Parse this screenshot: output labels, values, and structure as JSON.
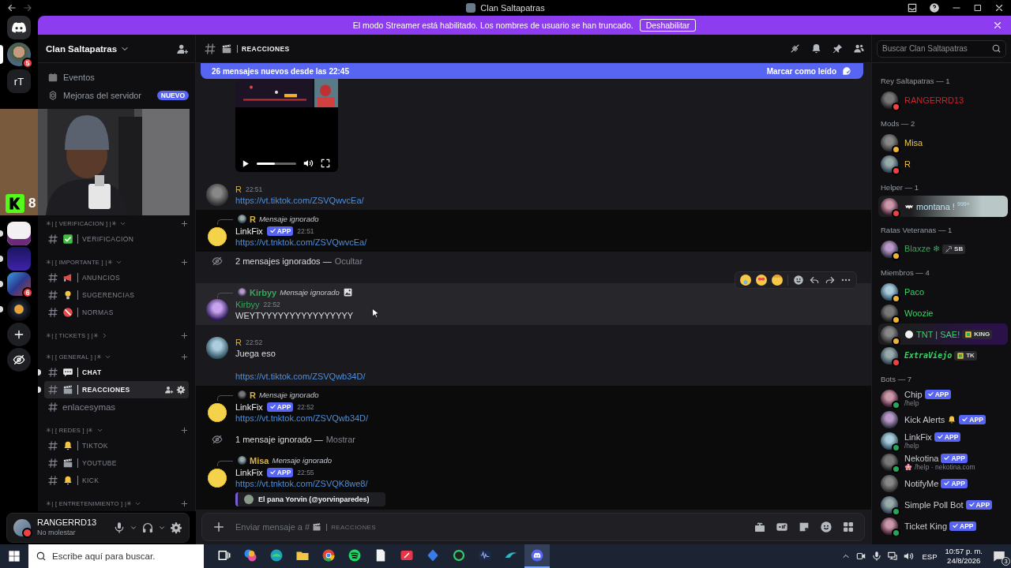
{
  "titlebar": {
    "title": "Clan Saltapatras"
  },
  "banner": {
    "text": "El modo Streamer está habilitado. Los nombres de usuario se han truncado.",
    "button": "Deshabilitar"
  },
  "server_rail": {
    "top": [
      {
        "kind": "home",
        "selected": false,
        "unread": false
      },
      {
        "kind": "avatar",
        "badge": "5",
        "selected": true,
        "unread": false
      },
      {
        "kind": "text",
        "label": "rT",
        "selected": false,
        "unread": false
      }
    ],
    "bottom": [
      {
        "kind": "dm",
        "selected": false,
        "unread": true
      },
      {
        "kind": "f",
        "selected": false,
        "unread": true
      },
      {
        "kind": "hat",
        "badge": "6",
        "selected": false,
        "unread": true
      },
      {
        "kind": "lamp",
        "selected": false,
        "unread": true
      },
      {
        "kind": "add",
        "selected": false,
        "unread": false
      },
      {
        "kind": "explore",
        "selected": false,
        "unread": false
      }
    ]
  },
  "webcam": {
    "kind": "picture",
    "overlay_count": "8"
  },
  "sidebar": {
    "server_name": "Clan Saltapatras",
    "links": [
      {
        "kind": "events",
        "label": "Eventos"
      },
      {
        "kind": "boost",
        "label": "Mejoras del servidor",
        "badge": "NUEVO"
      }
    ],
    "categories": [
      {
        "name": "✳| [ VERIFICACION ] |✳",
        "expanded": true,
        "channels": [
          {
            "kind": "check",
            "name": "VERIFICACION",
            "selected": false,
            "unread": false
          }
        ]
      },
      {
        "name": "✳| [ IMPORTANTE ] |✳",
        "expanded": true,
        "channels": [
          {
            "kind": "megaphone",
            "name": "ANUNCIOS",
            "selected": false,
            "unread": false
          },
          {
            "kind": "bulb",
            "name": "SUGERENCIAS",
            "selected": false,
            "unread": false
          },
          {
            "kind": "noentry",
            "name": "NORMAS",
            "selected": false,
            "unread": false
          }
        ]
      },
      {
        "name": "✳| [ TICKETS ] |✳",
        "expanded": false
      },
      {
        "name": "✳| [ GENERAL ] |✳",
        "expanded": true,
        "channels": [
          {
            "kind": "speech",
            "name": "CHAT",
            "selected": false,
            "unread": true
          },
          {
            "kind": "clapper",
            "name": "REACCIONES",
            "selected": true,
            "unread": true
          },
          {
            "kind": "plain",
            "name": "enlacesymas",
            "selected": false,
            "unread": false
          }
        ]
      },
      {
        "name": "✳| [ REDES ] |✳",
        "expanded": true,
        "channels": [
          {
            "kind": "bell",
            "name": "TIKTOK",
            "selected": false,
            "unread": false
          },
          {
            "kind": "clapper",
            "name": "YOUTUBE",
            "selected": false,
            "unread": false
          },
          {
            "kind": "bell",
            "name": "KICK",
            "selected": false,
            "unread": false
          }
        ]
      },
      {
        "name": "✳| [ ENTRETENIMIENTO ] |✳",
        "expanded": true
      }
    ]
  },
  "user_panel": {
    "name": "RANGERRD13",
    "status_text": "No molestar",
    "status": {
      "color": "#f23f43"
    }
  },
  "chat_header": {
    "name": "REACCIONES",
    "search_placeholder": "Buscar Clan Saltapatras"
  },
  "new_messages": {
    "text": "26 mensajes nuevos desde las 22:45",
    "action": "Marcar como leído"
  },
  "messages": [
    {
      "kind": "video",
      "progress": {
        "level": 0.45
      }
    },
    {
      "kind": "message",
      "ignored": false,
      "hovered": false,
      "author": "R",
      "color": "#d9b33e",
      "time": "22:51",
      "lines": [
        {
          "kind": "link",
          "text": "https://vt.tiktok.com/ZSVQwvcEa/",
          "spaced": false
        }
      ]
    },
    {
      "kind": "message",
      "ignored": true,
      "hovered": false,
      "reply": {
        "author": "R",
        "color": "#d9b33e",
        "text": "Mensaje ignorado",
        "attachment": false
      },
      "author": "LinkFix",
      "app_badge": "APP",
      "time": "22:51",
      "lines": [
        {
          "kind": "link",
          "text": "https://vt.tnktok.com/ZSVQwvcEa/",
          "spaced": false
        }
      ]
    },
    {
      "kind": "notice",
      "ignored": false,
      "text": "2 mensajes ignorados —",
      "action": "Ocultar"
    },
    {
      "kind": "message",
      "ignored": false,
      "hovered": true,
      "reply": {
        "author": "Kirbyy",
        "color": "#3ba55c",
        "text": "Mensaje ignorado",
        "attachment": true
      },
      "author": "Kirbyy",
      "color": "#3ba55c",
      "time": "22:52",
      "lines": [
        {
          "kind": "text",
          "text": "WEYTYYYYYYYYYYYYYYYY",
          "spaced": false
        }
      ]
    },
    {
      "kind": "message",
      "ignored": false,
      "hovered": false,
      "author": "R",
      "color": "#d9b33e",
      "time": "22:52",
      "lines": [
        {
          "kind": "text",
          "text": "Juega eso",
          "spaced": false
        },
        {
          "kind": "link",
          "text": "https://vt.tiktok.com/ZSVQwb34D/",
          "spaced": true
        }
      ]
    },
    {
      "kind": "message",
      "ignored": true,
      "hovered": false,
      "reply": {
        "author": "R",
        "color": "#d9b33e",
        "text": "Mensaje ignorado",
        "attachment": false
      },
      "author": "LinkFix",
      "app_badge": "APP",
      "time": "22:52",
      "lines": [
        {
          "kind": "link",
          "text": "https://vt.tnktok.com/ZSVQwb34D/",
          "spaced": false
        }
      ]
    },
    {
      "kind": "notice",
      "ignored": true,
      "text": "1 mensaje ignorado —",
      "action": "Mostrar"
    },
    {
      "kind": "message",
      "ignored": true,
      "hovered": false,
      "reply": {
        "author": "Misa",
        "color": "#d9b33e",
        "text": "Mensaje ignorado",
        "attachment": false
      },
      "author": "LinkFix",
      "app_badge": "APP",
      "time": "22:55",
      "lines": [
        {
          "kind": "link",
          "text": "https://vt.tnktok.com/ZSVQK8we8/",
          "spaced": false
        }
      ],
      "embed": {
        "author": "El pana Yorvin (@yorvinparedes)"
      }
    }
  ],
  "composer": {
    "placeholder": "Enviar mensaje a #",
    "channel": "REACCIONES"
  },
  "member_groups": [
    {
      "title": "Rey Saltapatras — 1",
      "members": [
        {
          "kind": "plain",
          "name": "RANGERRD13",
          "color": "#d61f26",
          "status": {
            "color": "#f23f43"
          }
        }
      ]
    },
    {
      "title": "Mods — 2",
      "members": [
        {
          "kind": "plain",
          "name": "Misa",
          "color": "#e8c547",
          "status": {
            "color": "#f0b232"
          }
        },
        {
          "kind": "plain",
          "name": "R",
          "color": "#e8b84a",
          "status": {
            "color": "#f23f43"
          }
        }
      ]
    },
    {
      "title": "Helper — 1",
      "members": [
        {
          "kind": "bat",
          "name": "montana ! $^{999+}$",
          "color": "#bfe3f0",
          "status": {
            "color": "#f23f43"
          },
          "nameplate": {
            "color": "#b9c7c7"
          }
        }
      ]
    },
    {
      "title": "Ratas Veteranas — 1",
      "members": [
        {
          "kind": "plain",
          "name": "Blaxze ❄",
          "color": "#3ba55c",
          "status": {
            "color": "#f0b232"
          },
          "tag": {
            "kind": "sword",
            "label": "SB"
          }
        }
      ]
    },
    {
      "title": "Miembros — 4",
      "members": [
        {
          "kind": "plain",
          "name": "Paco",
          "color": "#3ecf6a",
          "status": {
            "color": "#f0b232"
          }
        },
        {
          "kind": "plain",
          "name": "Woozie",
          "color": "#3ecf6a",
          "status": {
            "color": "#f0b232"
          }
        },
        {
          "kind": "circle",
          "name": "TNT | SAE!",
          "color": "#3ecf6a",
          "status": {
            "color": "#f0b232"
          },
          "nameplate": {
            "color": "#2a1248"
          },
          "tag": {
            "kind": "frame",
            "label": "KING"
          }
        },
        {
          "kind": "mono",
          "name": "ExtraViejo",
          "color": "#3ecf6a",
          "status": {
            "color": "#f23f43"
          },
          "tag": {
            "kind": "frame",
            "label": "TK"
          }
        }
      ]
    },
    {
      "title": "Bots — 7",
      "members": [
        {
          "kind": "plain",
          "name": "Chip",
          "status": {
            "color": "#23a55a"
          },
          "app_badge": "APP",
          "activity": "/help"
        },
        {
          "kind": "bell",
          "name": "Kick Alerts",
          "app_badge": "APP"
        },
        {
          "kind": "plain",
          "name": "LinkFix",
          "status": {
            "color": "#23a55a"
          },
          "app_badge": "APP",
          "activity": "/help"
        },
        {
          "kind": "flower",
          "name": "Nekotina",
          "status": {
            "color": "#23a55a"
          },
          "app_badge": "APP",
          "activity": "/help · nekotina.com"
        },
        {
          "kind": "plain",
          "name": "NotifyMe",
          "app_badge": "APP"
        },
        {
          "kind": "plain",
          "name": "Simple Poll Bot",
          "status": {
            "color": "#23a55a"
          },
          "app_badge": "APP"
        },
        {
          "kind": "plain",
          "name": "Ticket King",
          "status": {
            "color": "#23a55a"
          },
          "app_badge": "APP"
        }
      ]
    }
  ],
  "taskbar": {
    "search_placeholder": "Escribe aquí para buscar.",
    "apps": [
      {
        "kind": "taskview",
        "selected": false
      },
      {
        "kind": "swirl",
        "selected": false
      },
      {
        "kind": "wave",
        "selected": false
      },
      {
        "kind": "folder",
        "selected": false
      },
      {
        "kind": "browser",
        "selected": false
      },
      {
        "kind": "music",
        "selected": false
      },
      {
        "kind": "document",
        "selected": false
      },
      {
        "kind": "redtile",
        "selected": false
      },
      {
        "kind": "diamond",
        "selected": false
      },
      {
        "kind": "ring",
        "selected": false
      },
      {
        "kind": "waveform",
        "selected": false
      },
      {
        "kind": "bird",
        "selected": false
      },
      {
        "kind": "chat",
        "selected": true
      }
    ],
    "language": "ESP",
    "time": "10:57 p. m.",
    "date": "24/8/2026",
    "notifications": "3"
  }
}
